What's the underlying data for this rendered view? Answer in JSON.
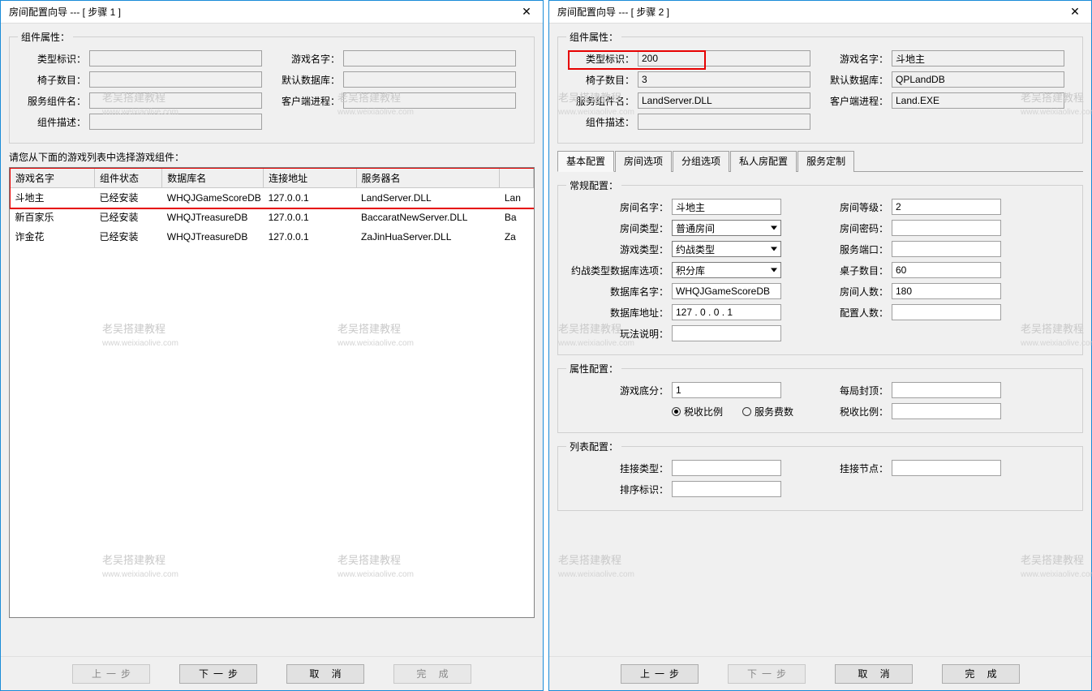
{
  "common": {
    "close_glyph": "✕",
    "watermark": {
      "line1": "老吴搭建教程",
      "line2": "www.weixiaolive.com"
    },
    "buttons": {
      "prev": "上一步",
      "next": "下一步",
      "cancel": "取 消",
      "finish": "完 成"
    },
    "group_component_attrs": "组件属性：",
    "labels": {
      "type_id": "类型标识：",
      "game_name": "游戏名字：",
      "chair_count": "椅子数目：",
      "default_db": "默认数据库：",
      "service_module": "服务组件名：",
      "client_process": "客户端进程：",
      "component_desc": "组件描述："
    }
  },
  "dialog1": {
    "title": "房间配置向导 --- [ 步骤 1 ]",
    "instruction": "请您从下面的游戏列表中选择游戏组件：",
    "table": {
      "headers": [
        "游戏名字",
        "组件状态",
        "数据库名",
        "连接地址",
        "服务器名",
        ""
      ],
      "rows": [
        [
          "斗地主",
          "已经安装",
          "WHQJGameScoreDB",
          "127.0.0.1",
          "LandServer.DLL",
          "Lan"
        ],
        [
          "新百家乐",
          "已经安装",
          "WHQJTreasureDB",
          "127.0.0.1",
          "BaccaratNewServer.DLL",
          "Ba"
        ],
        [
          "诈金花",
          "已经安装",
          "WHQJTreasureDB",
          "127.0.0.1",
          "ZaJinHuaServer.DLL",
          "Za"
        ]
      ]
    }
  },
  "dialog2": {
    "title": "房间配置向导 --- [ 步骤 2 ]",
    "attrs": {
      "type_id": "200",
      "game_name": "斗地主",
      "chair_count": "3",
      "default_db": "QPLandDB",
      "service_module": "LandServer.DLL",
      "client_process": "Land.EXE",
      "component_desc": ""
    },
    "tabs": [
      "基本配置",
      "房间选项",
      "分组选项",
      "私人房配置",
      "服务定制"
    ],
    "sections": {
      "general": {
        "legend": "常规配置：",
        "labels": {
          "room_name": "房间名字：",
          "room_level": "房间等级：",
          "room_type": "房间类型：",
          "room_pwd": "房间密码：",
          "game_type": "游戏类型：",
          "service_port": "服务端口：",
          "battle_db_opt": "约战类型数据库选项：",
          "table_count": "桌子数目：",
          "db_name": "数据库名字：",
          "room_capacity": "房间人数：",
          "db_addr": "数据库地址：",
          "config_capacity": "配置人数：",
          "play_desc": "玩法说明："
        },
        "values": {
          "room_name": "斗地主",
          "room_level": "2",
          "room_type": "普通房间",
          "room_pwd": "",
          "game_type": "约战类型",
          "service_port": "",
          "battle_db_opt": "积分库",
          "table_count": "60",
          "db_name": "WHQJGameScoreDB",
          "room_capacity": "180",
          "db_addr": "127 . 0  . 0  . 1",
          "config_capacity": "",
          "play_desc": ""
        }
      },
      "attr_cfg": {
        "legend": "属性配置：",
        "labels": {
          "game_score": "游戏底分：",
          "round_cap": "每局封顶：",
          "tax_ratio_radio": "税收比例",
          "service_fee_radio": "服务费数",
          "tax_ratio": "税收比例："
        },
        "values": {
          "game_score": "1",
          "round_cap": "",
          "tax_ratio": ""
        }
      },
      "list_cfg": {
        "legend": "列表配置：",
        "labels": {
          "attach_type": "挂接类型：",
          "attach_node": "挂接节点：",
          "sort_id": "排序标识："
        },
        "values": {
          "attach_type": "",
          "attach_node": "",
          "sort_id": ""
        }
      }
    }
  }
}
